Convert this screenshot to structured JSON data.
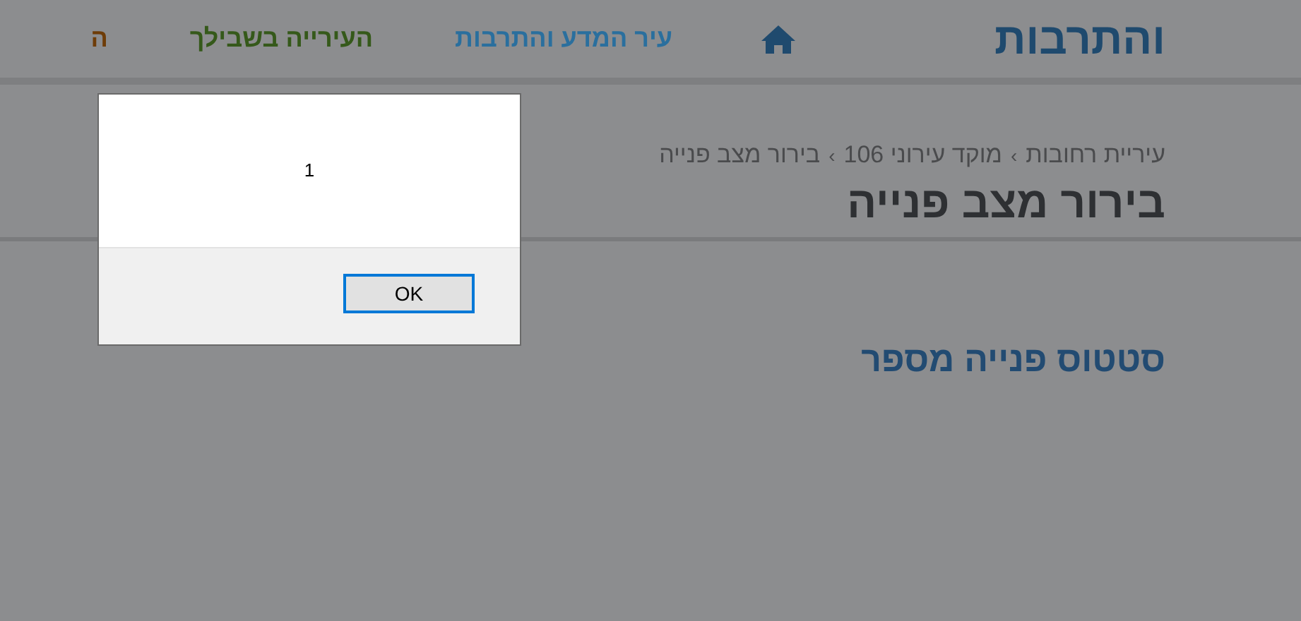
{
  "header": {
    "logo": "והתרבות",
    "nav": [
      {
        "label": "עיר המדע והתרבות",
        "color": "#2a6f9e"
      },
      {
        "label": "העירייה בשבילך",
        "color": "#35591a"
      },
      {
        "label": "ה",
        "color": "#6e3c08"
      }
    ]
  },
  "breadcrumb": [
    "עיריית רחובות",
    "מוקד עירוני 106",
    "בירור מצב פנייה"
  ],
  "breadcrumb_separator": "›",
  "page_title": "בירור מצב פנייה",
  "section_heading": "סטטוס פנייה מספר",
  "dialog": {
    "message": "1",
    "button": "OK"
  }
}
